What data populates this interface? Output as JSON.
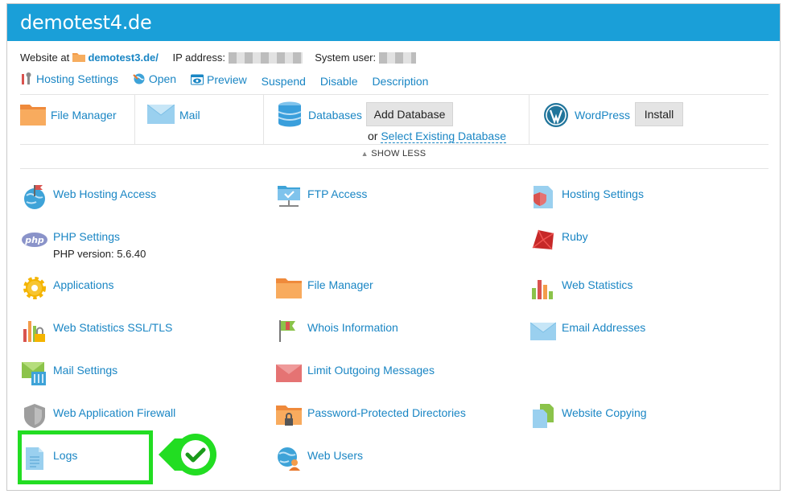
{
  "header": {
    "title": "demotest4.de"
  },
  "info": {
    "website_at_label": "Website at",
    "website_domain": "demotest3.de/",
    "ip_label": "IP address:",
    "system_user_label": "System user:"
  },
  "actions": {
    "hosting_settings": "Hosting Settings",
    "open": "Open",
    "preview": "Preview",
    "suspend": "Suspend",
    "disable": "Disable",
    "description": "Description"
  },
  "quick": {
    "file_manager": "File Manager",
    "mail": "Mail",
    "databases": "Databases",
    "add_database": "Add Database",
    "or": "or",
    "select_existing_database": "Select Existing Database",
    "wordpress": "WordPress",
    "install": "Install"
  },
  "show_less": "SHOW LESS",
  "tools": {
    "web_hosting_access": "Web Hosting Access",
    "ftp_access": "FTP Access",
    "hosting_settings": "Hosting Settings",
    "php_settings": "PHP Settings",
    "php_version": "PHP version: 5.6.40",
    "ruby": "Ruby",
    "applications": "Applications",
    "file_manager": "File Manager",
    "web_statistics": "Web Statistics",
    "web_statistics_ssl": "Web Statistics SSL/TLS",
    "whois_information": "Whois Information",
    "email_addresses": "Email Addresses",
    "mail_settings": "Mail Settings",
    "limit_outgoing_messages": "Limit Outgoing Messages",
    "web_application_firewall": "Web Application Firewall",
    "password_protected_directories": "Password-Protected Directories",
    "website_copying": "Website Copying",
    "logs": "Logs",
    "web_users": "Web Users"
  },
  "colors": {
    "accent": "#1a9fd8",
    "link": "#1a86c4",
    "highlight": "#22dd22"
  }
}
